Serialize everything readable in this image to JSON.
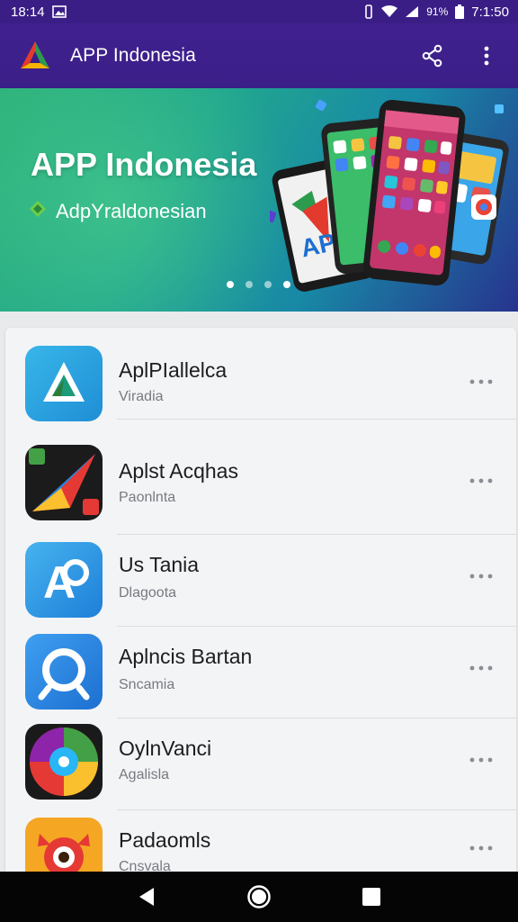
{
  "status_bar": {
    "left_time": "18:14",
    "battery_percent": "91%",
    "clock": "7:1:50"
  },
  "app_bar": {
    "title": "APP Indonesia",
    "icons": [
      "app-logo-icon",
      "share-icon",
      "more-vert-icon"
    ]
  },
  "banner": {
    "title": "APP Indonesia",
    "subtitle": "AdpYraldonesian",
    "dots_count": 4,
    "active_dot": 1
  },
  "apps": [
    {
      "name": "AplPIallelca",
      "subtitle": "Viradia",
      "icon": "triangle-app-icon"
    },
    {
      "name": "Aplst Acqhas",
      "subtitle": "Paonlnta",
      "icon": "paper-plane-app-icon"
    },
    {
      "name": "Us Tania",
      "subtitle": "Dlagoota",
      "icon": "letter-a-app-icon"
    },
    {
      "name": "Aplncis Bartan",
      "subtitle": "Sncamia",
      "icon": "search-ring-app-icon"
    },
    {
      "name": "OylnVanci",
      "subtitle": "Agalisla",
      "icon": "game-wheel-app-icon"
    },
    {
      "name": "Padaomls",
      "subtitle": "Cnsvala",
      "icon": "owl-app-icon"
    }
  ],
  "nav_bar": {
    "icons": [
      "back-icon",
      "home-icon",
      "recents-icon"
    ]
  },
  "colors": {
    "app_bar": "#3b1f88",
    "banner_start": "#2fb37b",
    "banner_end": "#27338e",
    "list_background": "#f3f4f6"
  }
}
